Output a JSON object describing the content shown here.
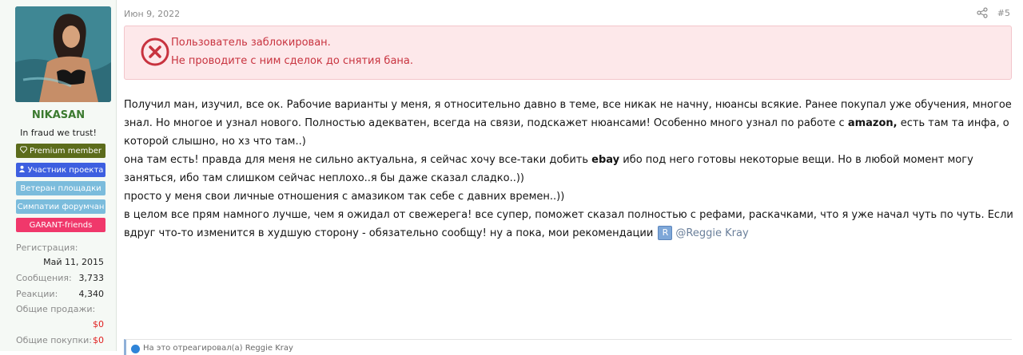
{
  "user": {
    "name": "NIKASAN",
    "title": "In fraud we trust!",
    "badges": [
      {
        "label": "Premium member",
        "icon": "diamond-icon"
      },
      {
        "label": "Участник проекта",
        "icon": "user-icon"
      },
      {
        "label": "Ветеран площадки"
      },
      {
        "label": "Симпатии форумчан"
      },
      {
        "label": "GARANT-friends"
      }
    ],
    "stats": {
      "registration_label": "Регистрация:",
      "registration_value": "Май 11, 2015",
      "messages_label": "Сообщения:",
      "messages_value": "3,733",
      "reactions_label": "Реакции:",
      "reactions_value": "4,340",
      "sales_label": "Общие продажи:",
      "sales_value": "$0",
      "purchases_label": "Общие покупки:",
      "purchases_value": "$0"
    }
  },
  "post": {
    "date": "Июн 9, 2022",
    "number": "#5",
    "ban_line1": "Пользователь заблокирован.",
    "ban_line2": "Не проводите с ним сделок до снятия бана.",
    "p1_a": "Получил ман, изучил, все ок. Рабочие варианты у меня, я относительно давно в теме, все никак не начну, нюансы всякие. Ранее покупал уже обучения, многое знал. Но многое и узнал нового. Полностью адекватен, всегда на связи, подскажет нюансами! Особенно много узнал по работе с ",
    "p1_bold": "amazon,",
    "p1_b": " есть там та инфа, о которой слышно, но хз что там..)",
    "p2_a": "она там есть! правда для меня не сильно актуальна, я сейчас хочу все-таки добить ",
    "p2_bold": "ebay",
    "p2_b": " ибо под него готовы некоторые вещи. Но в любой момент могу заняться, ибо там слишком сейчас неплохо..я бы даже сказал сладко..))",
    "p3": "просто у меня свои личные отношения с амазиком так себе с давних времен..))",
    "p4": "в целом все прям намного лучше, чем я ожидал от свежерега! все супер, поможет сказал полностью с рефами, раскачками, что я уже начал чуть по чуть. Если вдруг что-то изменится в худшую сторону - обязательно сообщу! ну а пока, мои рекомендации",
    "mention_letter": "R",
    "mention_name": "@Reggie Kray",
    "reactions_text": "На это отреагировал(а) Reggie Kray"
  },
  "colors": {
    "ban_bg": "#fde8ea",
    "ban_text": "#c8333f",
    "username": "#3b7a2f",
    "stat_red": "#e02020"
  }
}
